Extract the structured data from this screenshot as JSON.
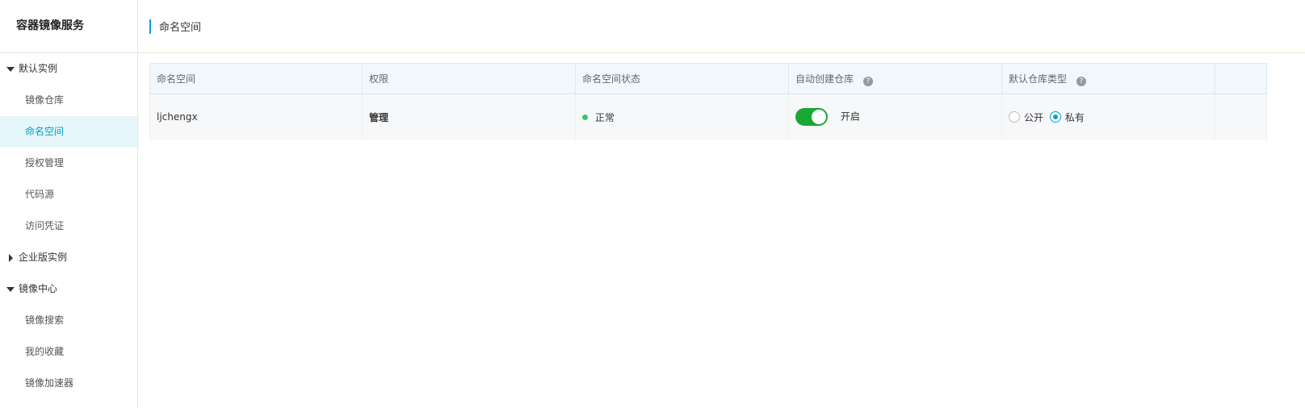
{
  "sidebar": {
    "title": "容器镜像服务",
    "groups": [
      {
        "label": "默认实例",
        "expanded": true,
        "items": [
          {
            "label": "镜像仓库",
            "active": false
          },
          {
            "label": "命名空间",
            "active": true
          },
          {
            "label": "授权管理",
            "active": false
          },
          {
            "label": "代码源",
            "active": false
          },
          {
            "label": "访问凭证",
            "active": false
          }
        ]
      },
      {
        "label": "企业版实例",
        "expanded": false,
        "items": []
      },
      {
        "label": "镜像中心",
        "expanded": true,
        "items": [
          {
            "label": "镜像搜索",
            "active": false
          },
          {
            "label": "我的收藏",
            "active": false
          },
          {
            "label": "镜像加速器",
            "active": false
          }
        ]
      }
    ]
  },
  "header": {
    "title": "命名空间"
  },
  "table": {
    "columns": [
      "命名空间",
      "权限",
      "命名空间状态",
      "自动创建仓库",
      "默认仓库类型",
      ""
    ],
    "help_icon": "?",
    "rows": [
      {
        "namespace": "ljchengx",
        "permission": "管理",
        "status": "正常",
        "auto_create": {
          "enabled": true,
          "label": "开启"
        },
        "repo_type": {
          "options": [
            "公开",
            "私有"
          ],
          "selected": "私有"
        }
      }
    ]
  },
  "colors": {
    "accent": "#00a2ca",
    "toggle_on": "#18a833",
    "status_ok": "#3fc26a"
  },
  "icons": [
    "caret-down-icon",
    "caret-right-icon",
    "help-icon",
    "status-dot-icon"
  ]
}
